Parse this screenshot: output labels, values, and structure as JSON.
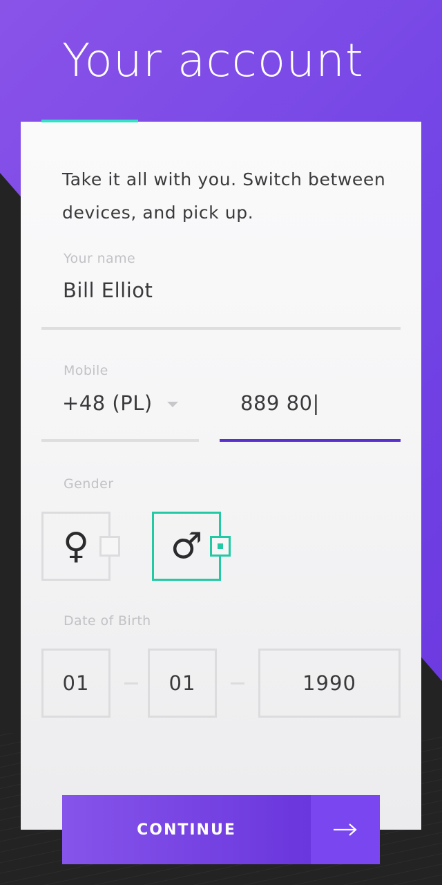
{
  "header": {
    "title": "Your account"
  },
  "intro": "Take it all with you. Switch between devices, and pick up.",
  "form": {
    "name": {
      "label": "Your name",
      "value": "Bill Elliot"
    },
    "mobile": {
      "label": "Mobile",
      "country_code": "+48 (PL)",
      "number": "889 80|"
    },
    "gender": {
      "label": "Gender",
      "female_symbol": "♀",
      "male_symbol": "♂",
      "selected": "male"
    },
    "dob": {
      "label": "Date of Birth",
      "day": "01",
      "month": "01",
      "year": "1990"
    }
  },
  "continue_button": {
    "label": "CONTINUE",
    "icon": "arrow-right-icon"
  },
  "colors": {
    "accent_purple": "#7345e6",
    "accent_teal": "#2fe3c4",
    "selected_green": "#22c9a2",
    "active_line": "#5a2fd0"
  }
}
